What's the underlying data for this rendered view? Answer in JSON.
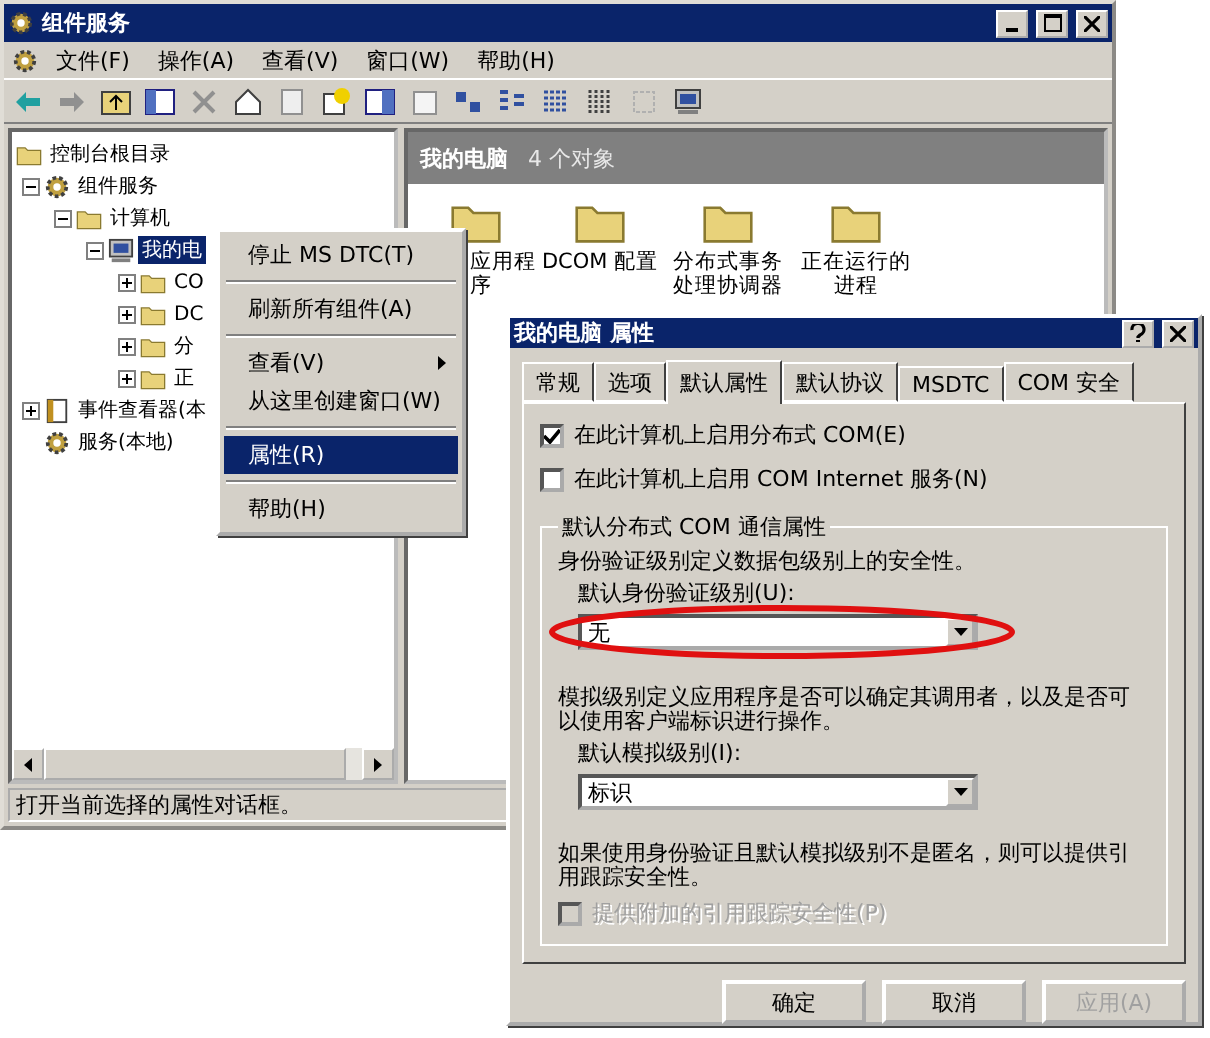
{
  "main_window": {
    "title": "组件服务",
    "menu": [
      "文件(F)",
      "操作(A)",
      "查看(V)",
      "窗口(W)",
      "帮助(H)"
    ],
    "tree": [
      {
        "label": "控制台根目录",
        "kind": "folder",
        "selected": false,
        "children": [
          {
            "label": "组件服务",
            "kind": "gear",
            "expanded": true,
            "selected": false,
            "children": [
              {
                "label": "计算机",
                "kind": "folder",
                "expanded": true,
                "selected": false,
                "children": [
                  {
                    "label": "我的电",
                    "kind": "computer",
                    "expanded": true,
                    "selected": true,
                    "children": [
                      {
                        "label": "CO",
                        "kind": "folder",
                        "expanded": false,
                        "selected": false
                      },
                      {
                        "label": "DC",
                        "kind": "folder",
                        "expanded": false,
                        "selected": false
                      },
                      {
                        "label": "分",
                        "kind": "folder",
                        "expanded": false,
                        "selected": false
                      },
                      {
                        "label": "正",
                        "kind": "folder",
                        "expanded": false,
                        "selected": false
                      }
                    ]
                  }
                ]
              }
            ]
          },
          {
            "label": "事件查看器(本",
            "kind": "log",
            "expanded": false,
            "selected": false
          },
          {
            "label": "服务(本地)",
            "kind": "gear",
            "selected": false
          }
        ]
      }
    ],
    "pane_header": {
      "title": "我的电脑",
      "count": "4 个对象"
    },
    "list_items": [
      {
        "lines": [
          "应用程",
          "序"
        ]
      },
      {
        "lines": [
          "DCOM 配置"
        ]
      },
      {
        "lines": [
          "分布式事务",
          "处理协调器"
        ]
      },
      {
        "lines": [
          "正在运行的",
          "进程"
        ]
      }
    ],
    "status_bar": "打开当前选择的属性对话框。"
  },
  "context_menu": [
    {
      "kind": "item",
      "label": "停止 MS DTC(T)",
      "selected": false
    },
    {
      "kind": "separator"
    },
    {
      "kind": "item",
      "label": "刷新所有组件(A)",
      "selected": false
    },
    {
      "kind": "separator"
    },
    {
      "kind": "submenu",
      "label": "查看(V)",
      "selected": false
    },
    {
      "kind": "item",
      "label": "从这里创建窗口(W)",
      "selected": false
    },
    {
      "kind": "separator"
    },
    {
      "kind": "item",
      "label": "属性(R)",
      "selected": true
    },
    {
      "kind": "separator"
    },
    {
      "kind": "item",
      "label": "帮助(H)",
      "selected": false
    }
  ],
  "dialog": {
    "title": "我的电脑 属性",
    "tabs": [
      {
        "label": "常规",
        "selected": false
      },
      {
        "label": "选项",
        "selected": false
      },
      {
        "label": "默认属性",
        "selected": true
      },
      {
        "label": "默认协议",
        "selected": false
      },
      {
        "label": "MSDTC",
        "selected": false
      },
      {
        "label": "COM 安全",
        "selected": false
      }
    ],
    "checkboxes": [
      {
        "label": "在此计算机上启用分布式 COM(E)",
        "checked": true
      },
      {
        "label": "在此计算机上启用 COM Internet 服务(N)",
        "checked": false
      }
    ],
    "group": {
      "title": "默认分布式 COM 通信属性",
      "auth_text": "身份验证级别定义数据包级别上的安全性。",
      "auth_combo": {
        "label": "默认身份验证级别(U):",
        "value": "无",
        "highlighted": true
      },
      "imp_text": "模拟级别定义应用程序是否可以确定其调用者，以及是否可以使用客户端标识进行操作。",
      "imp_combo": {
        "label": "默认模拟级别(I):",
        "value": "标识"
      },
      "track_text": "如果使用身份验证且默认模拟级别不是匿名，则可以提供引用跟踪安全性。",
      "track_checkbox": {
        "label": "提供附加的引用跟踪安全性(P)",
        "checked": false,
        "disabled": true
      }
    },
    "buttons": [
      {
        "label": "确定",
        "disabled": false
      },
      {
        "label": "取消",
        "disabled": false
      },
      {
        "label": "应用(A)",
        "disabled": true
      }
    ]
  }
}
